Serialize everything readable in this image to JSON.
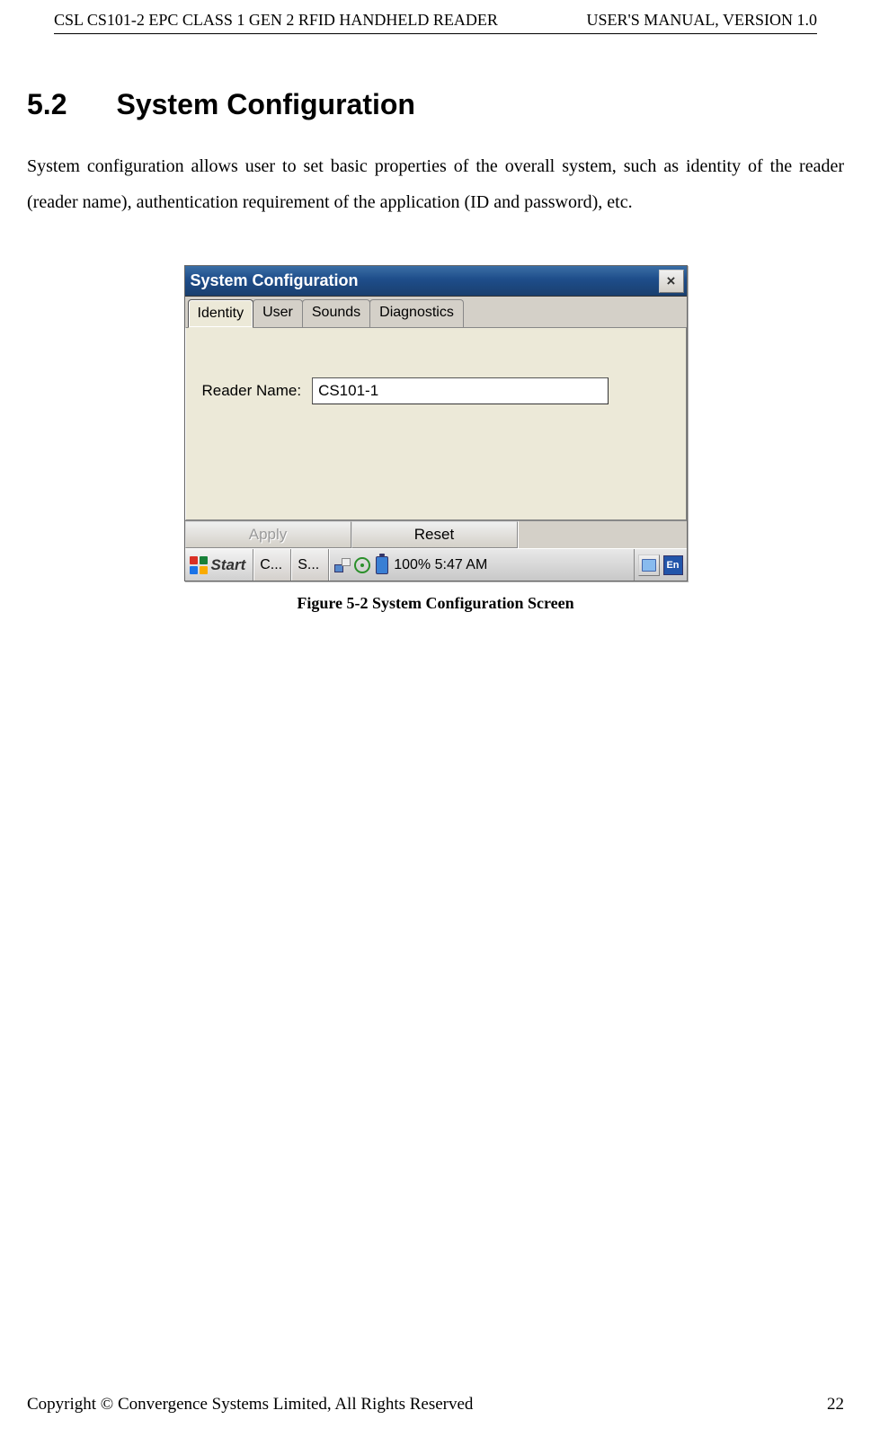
{
  "header": {
    "left": "CSL CS101-2 EPC CLASS 1 GEN 2 RFID HANDHELD READER",
    "right": "USER'S  MANUAL,  VERSION  1.0"
  },
  "section": {
    "number": "5.2",
    "title": "System Configuration"
  },
  "body_paragraph": "System configuration allows user to set basic properties of the overall system, such as identity of the reader (reader name), authentication requirement of the application (ID and password), etc.",
  "screenshot": {
    "window_title": "System Configuration",
    "close_label": "×",
    "tabs": {
      "identity": "Identity",
      "user": "User",
      "sounds": "Sounds",
      "diagnostics": "Diagnostics"
    },
    "form": {
      "reader_name_label": "Reader Name:",
      "reader_name_value": "CS101-1"
    },
    "buttons": {
      "apply": "Apply",
      "reset": "Reset"
    },
    "taskbar": {
      "start": "Start",
      "task1": "C...",
      "task2": "S...",
      "battery_text": "100% 5:47 AM",
      "keyboard_label": "En"
    }
  },
  "figure_caption": "Figure 5-2 System Configuration Screen",
  "footer": {
    "copyright": "Copyright © Convergence Systems Limited, All Rights Reserved",
    "page": "22"
  }
}
